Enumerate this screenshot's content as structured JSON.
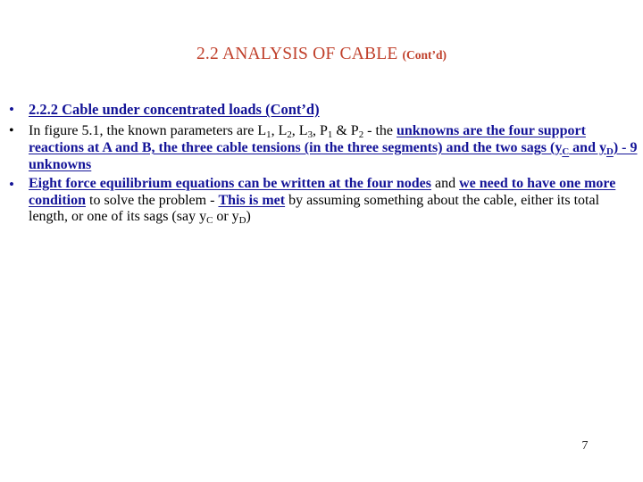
{
  "slide": {
    "page_number": "7",
    "background_color": "#ffffff",
    "title": {
      "main": "2.2 ANALYSIS OF CABLE ",
      "continuation": "(Cont’d)",
      "color": "#C0402B"
    },
    "accent_colors": {
      "title": "#C0402B",
      "emphasis": "#141498",
      "body": "#000000"
    },
    "bullets": [
      {
        "level": 1,
        "marker": "•",
        "marker_color": "#141498",
        "text": "2.2.2 Cable under concentrated loads (Cont’d)",
        "style": "bold-underline-navy"
      },
      {
        "level": 2,
        "marker": "•",
        "marker_color": "#000000",
        "runs": [
          {
            "text": "In figure 5.1, the known parameters are L",
            "style": "plain"
          },
          {
            "text": "1",
            "style": "plain-sub"
          },
          {
            "text": ", L",
            "style": "plain"
          },
          {
            "text": "2",
            "style": "plain-sub"
          },
          {
            "text": ", L",
            "style": "plain"
          },
          {
            "text": "3",
            "style": "plain-sub"
          },
          {
            "text": ", P",
            "style": "plain"
          },
          {
            "text": "1",
            "style": "plain-sub"
          },
          {
            "text": " & P",
            "style": "plain"
          },
          {
            "text": "2",
            "style": "plain-sub"
          },
          {
            "text": " - the ",
            "style": "plain"
          },
          {
            "text": "unknowns are the four support reactions at A and B, the three cable tensions (in the three segments) and the two sags (y",
            "style": "em"
          },
          {
            "text": "C",
            "style": "em-sub"
          },
          {
            "text": " and y",
            "style": "em"
          },
          {
            "text": "D",
            "style": "em-sub"
          },
          {
            "text": ") - 9 unknowns",
            "style": "em"
          }
        ]
      },
      {
        "level": 2,
        "marker": "•",
        "marker_color": "#141498",
        "runs": [
          {
            "text": "Eight force equilibrium equations can be written at the four nodes",
            "style": "em"
          },
          {
            "text": " and ",
            "style": "plain"
          },
          {
            "text": "we need to have one more condition",
            "style": "em"
          },
          {
            "text": " to solve the problem - ",
            "style": "plain"
          },
          {
            "text": "This is met",
            "style": "em"
          },
          {
            "text": " by assuming something about the cable, either its total length, or one of its sags (say y",
            "style": "plain"
          },
          {
            "text": "C",
            "style": "plain-sub"
          },
          {
            "text": " or y",
            "style": "plain"
          },
          {
            "text": "D",
            "style": "plain-sub"
          },
          {
            "text": ")",
            "style": "plain"
          }
        ]
      }
    ]
  }
}
